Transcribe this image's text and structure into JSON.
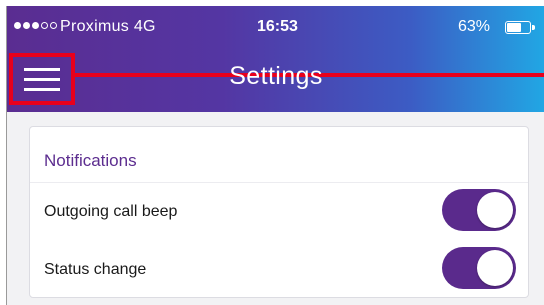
{
  "status_bar": {
    "carrier": "Proximus  4G",
    "time": "16:53",
    "battery_percent": "63%",
    "battery_level": 0.63,
    "signal_bars": 3,
    "signal_total": 5
  },
  "header": {
    "title": "Settings",
    "menu_icon": "hamburger-menu-icon",
    "gradient_colors": [
      "#5a2d91",
      "#3c5cc4",
      "#21a7e4"
    ],
    "highlight_color": "#e8001c"
  },
  "notifications": {
    "section_title": "Notifications",
    "items": [
      {
        "label": "Outgoing call beep",
        "enabled": true
      },
      {
        "label": "Status change",
        "enabled": true
      }
    ],
    "toggle_on_color": "#5a2a8c"
  }
}
